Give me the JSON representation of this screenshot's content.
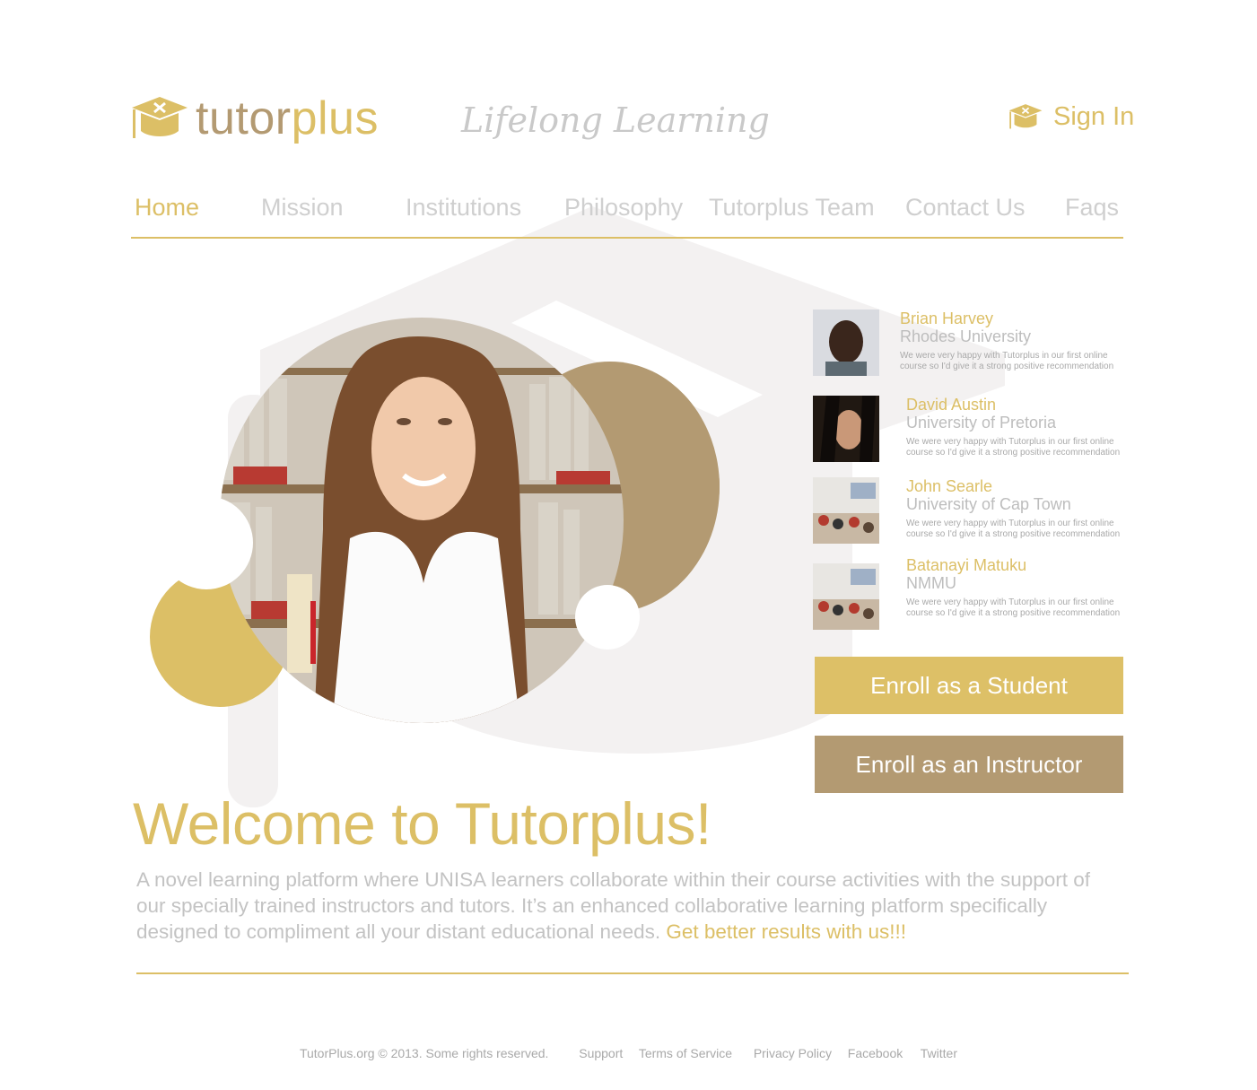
{
  "brand": {
    "part1": "tutor",
    "part2": "plus",
    "tagline": "Lifelong Learning"
  },
  "header": {
    "signin_label": "Sign In"
  },
  "nav": {
    "items": [
      {
        "label": "Home",
        "active": true
      },
      {
        "label": "Mission"
      },
      {
        "label": "Institutions"
      },
      {
        "label": "Philosophy"
      },
      {
        "label": "Tutorplus Team"
      },
      {
        "label": "Contact Us"
      },
      {
        "label": "Faqs"
      }
    ]
  },
  "testimonials": [
    {
      "name": "Brian Harvey",
      "institution": "Rhodes University",
      "quote": "We were very happy with Tutorplus in our first online course so I'd give it a strong positive recommendation"
    },
    {
      "name": "David Austin",
      "institution": "University of Pretoria",
      "quote": "We were very happy with Tutorplus in our first online course so I'd give it a strong positive recommendation"
    },
    {
      "name": "John Searle",
      "institution": "University of Cap Town",
      "quote": "We were very happy with Tutorplus in our first online course so I'd give it a strong positive recommendation"
    },
    {
      "name": "Batanayi Matuku",
      "institution": "NMMU",
      "quote": "We were very happy with Tutorplus in our first online course so I'd give it a strong positive recommendation"
    }
  ],
  "buttons": {
    "student": "Enroll as a Student",
    "instructor": "Enroll as an Instructor"
  },
  "welcome": {
    "title": "Welcome to Tutorplus!",
    "body": " A novel learning platform where UNISA learners collaborate within their course activities with the support of our specially trained instructors and tutors. It’s an enhanced collaborative learning platform specifically designed to compliment all your distant educational needs. ",
    "highlight": "Get better results with us!!!"
  },
  "footer": {
    "copyright": "TutorPlus.org © 2013. Some rights reserved.",
    "links": [
      "Support",
      "Terms of Service",
      "Privacy Policy",
      "Facebook",
      "Twitter"
    ]
  },
  "colors": {
    "gold": "#dcbf66",
    "tan": "#b39a72",
    "grey_text": "#c3c3c3"
  },
  "icons": {
    "logo": "graduation-cap-icon",
    "signin": "graduation-cap-icon"
  }
}
